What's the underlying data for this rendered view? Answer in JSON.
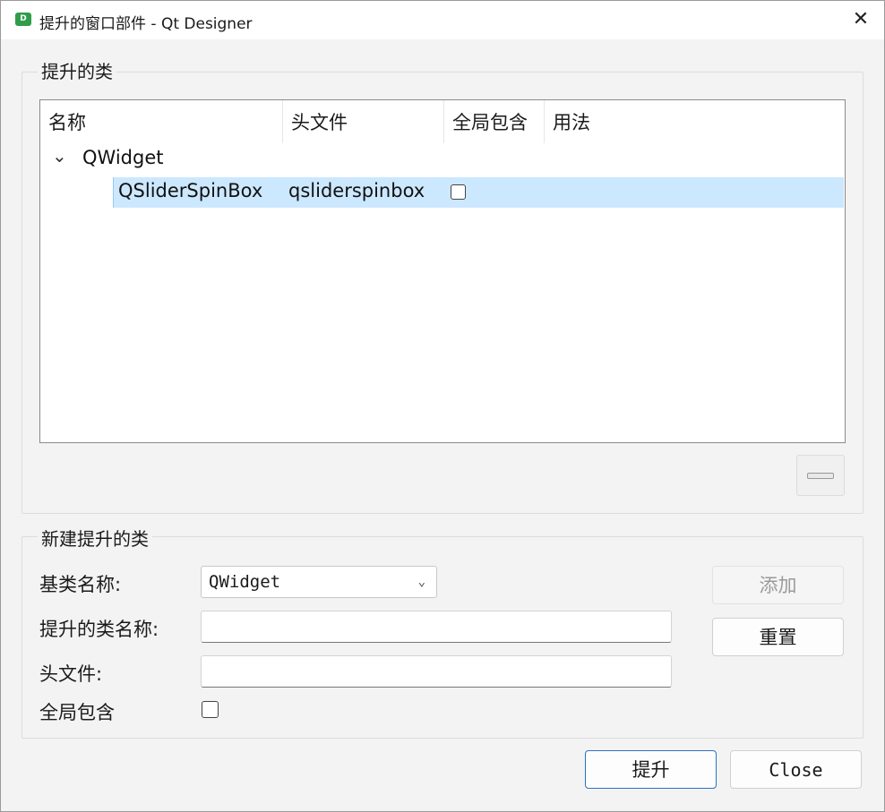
{
  "window": {
    "title": "提升的窗口部件 - Qt Designer",
    "app_icon_glyph": "D",
    "close_glyph": "✕"
  },
  "promoted_group": {
    "title": "提升的类",
    "columns": [
      "名称",
      "头文件",
      "全局包含",
      "用法"
    ],
    "tree": {
      "expander_glyph": "⌄",
      "parent": "QWidget",
      "child": {
        "name": "QSliderSpinBox",
        "header": "qsliderspinbox",
        "global_include_checked": false
      }
    }
  },
  "new_group": {
    "title": "新建提升的类",
    "base_class_label": "基类名称:",
    "base_class_value": "QWidget",
    "combo_arrow_glyph": "⌄",
    "promoted_class_label": "提升的类名称:",
    "promoted_class_value": "",
    "header_file_label": "头文件:",
    "header_file_value": "",
    "global_include_label": "全局包含",
    "global_include_checked": false,
    "add_button": "添加",
    "reset_button": "重置"
  },
  "footer": {
    "promote_button": "提升",
    "close_button": "Close"
  },
  "colors": {
    "selection": "#cce8ff",
    "default_button_border": "#2a72c2",
    "app_icon": "#2e9d4a"
  }
}
